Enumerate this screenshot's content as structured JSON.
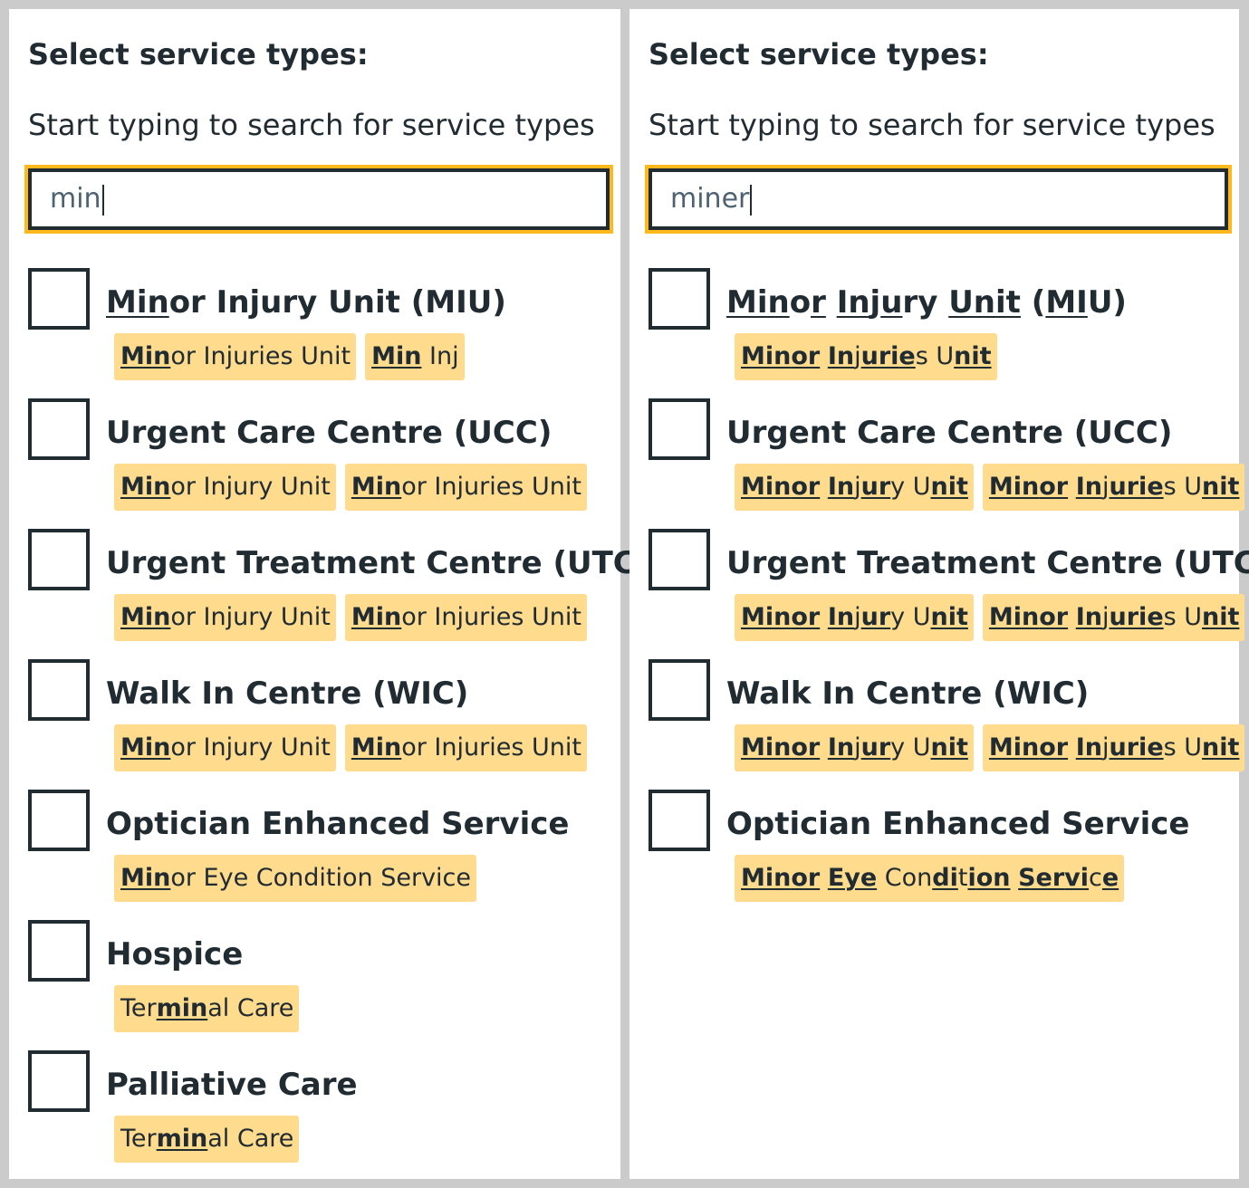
{
  "left": {
    "heading": "Select service types:",
    "hint": "Start typing to search for service types",
    "query": "min",
    "options": [
      {
        "label": [
          {
            "t": "Min",
            "u": true
          },
          {
            "t": "or Injury Unit (MIU)",
            "u": false
          }
        ],
        "tags": [
          [
            {
              "t": "Min",
              "u": true
            },
            {
              "t": "or Injuries Unit",
              "u": false
            }
          ],
          [
            {
              "t": "Min",
              "u": true
            },
            {
              "t": " Inj",
              "u": false
            }
          ]
        ]
      },
      {
        "label": [
          {
            "t": "Urgent Care Centre (UCC)",
            "u": false
          }
        ],
        "tags": [
          [
            {
              "t": "Min",
              "u": true
            },
            {
              "t": "or Injury Unit",
              "u": false
            }
          ],
          [
            {
              "t": "Min",
              "u": true
            },
            {
              "t": "or Injuries Unit",
              "u": false
            }
          ]
        ]
      },
      {
        "label": [
          {
            "t": "Urgent Treatment Centre (UTC)",
            "u": false
          }
        ],
        "tags": [
          [
            {
              "t": "Min",
              "u": true
            },
            {
              "t": "or Injury Unit",
              "u": false
            }
          ],
          [
            {
              "t": "Min",
              "u": true
            },
            {
              "t": "or Injuries Unit",
              "u": false
            }
          ]
        ]
      },
      {
        "label": [
          {
            "t": "Walk In Centre (WIC)",
            "u": false
          }
        ],
        "tags": [
          [
            {
              "t": "Min",
              "u": true
            },
            {
              "t": "or Injury Unit",
              "u": false
            }
          ],
          [
            {
              "t": "Min",
              "u": true
            },
            {
              "t": "or Injuries Unit",
              "u": false
            }
          ]
        ]
      },
      {
        "label": [
          {
            "t": "Optician Enhanced Service",
            "u": false
          }
        ],
        "tags": [
          [
            {
              "t": "Min",
              "u": true
            },
            {
              "t": "or Eye Condition Service",
              "u": false
            }
          ]
        ]
      },
      {
        "label": [
          {
            "t": "Hospice",
            "u": false
          }
        ],
        "tags": [
          [
            {
              "t": "Ter",
              "u": false
            },
            {
              "t": "min",
              "u": true
            },
            {
              "t": "al Care",
              "u": false
            }
          ]
        ]
      },
      {
        "label": [
          {
            "t": "Palliative Care",
            "u": false
          }
        ],
        "tags": [
          [
            {
              "t": "Ter",
              "u": false
            },
            {
              "t": "min",
              "u": true
            },
            {
              "t": "al Care",
              "u": false
            }
          ]
        ]
      }
    ]
  },
  "right": {
    "heading": "Select service types:",
    "hint": "Start typing to search for service types",
    "query": "miner",
    "options": [
      {
        "label": [
          {
            "t": "Min",
            "u": true
          },
          {
            "t": "o",
            "u": false
          },
          {
            "t": "r",
            "u": true
          },
          {
            "t": " ",
            "u": false
          },
          {
            "t": "In",
            "u": true
          },
          {
            "t": "j",
            "u": false
          },
          {
            "t": "u",
            "u": true
          },
          {
            "t": "ry ",
            "u": false
          },
          {
            "t": "Un",
            "u": true
          },
          {
            "t": "it",
            "u": true
          },
          {
            "t": " (",
            "u": false
          },
          {
            "t": "MI",
            "u": true
          },
          {
            "t": "U)",
            "u": false
          }
        ],
        "tags": [
          [
            {
              "t": "Min",
              "u": true
            },
            {
              "t": "or",
              "u": true
            },
            {
              "t": " ",
              "u": false
            },
            {
              "t": "In",
              "u": true
            },
            {
              "t": "j",
              "u": false
            },
            {
              "t": "uri",
              "u": true
            },
            {
              "t": "e",
              "u": true
            },
            {
              "t": "s U",
              "u": false
            },
            {
              "t": "nit",
              "u": true
            }
          ]
        ]
      },
      {
        "label": [
          {
            "t": "Urgent Care Centre (UCC)",
            "u": false
          }
        ],
        "tags": [
          [
            {
              "t": "Min",
              "u": true
            },
            {
              "t": "or",
              "u": true
            },
            {
              "t": " ",
              "u": false
            },
            {
              "t": "In",
              "u": true
            },
            {
              "t": "j",
              "u": false
            },
            {
              "t": "ur",
              "u": true
            },
            {
              "t": "y U",
              "u": false
            },
            {
              "t": "nit",
              "u": true
            }
          ],
          [
            {
              "t": "Min",
              "u": true
            },
            {
              "t": "or",
              "u": true
            },
            {
              "t": " ",
              "u": false
            },
            {
              "t": "In",
              "u": true
            },
            {
              "t": "j",
              "u": false
            },
            {
              "t": "uri",
              "u": true
            },
            {
              "t": "e",
              "u": true
            },
            {
              "t": "s U",
              "u": false
            },
            {
              "t": "nit",
              "u": true
            }
          ]
        ]
      },
      {
        "label": [
          {
            "t": "Urgent Treatment Centre (UTC)",
            "u": false
          }
        ],
        "tags": [
          [
            {
              "t": "Min",
              "u": true
            },
            {
              "t": "or",
              "u": true
            },
            {
              "t": " ",
              "u": false
            },
            {
              "t": "In",
              "u": true
            },
            {
              "t": "j",
              "u": false
            },
            {
              "t": "ur",
              "u": true
            },
            {
              "t": "y U",
              "u": false
            },
            {
              "t": "nit",
              "u": true
            }
          ],
          [
            {
              "t": "Min",
              "u": true
            },
            {
              "t": "or",
              "u": true
            },
            {
              "t": " ",
              "u": false
            },
            {
              "t": "In",
              "u": true
            },
            {
              "t": "j",
              "u": false
            },
            {
              "t": "uri",
              "u": true
            },
            {
              "t": "e",
              "u": true
            },
            {
              "t": "s U",
              "u": false
            },
            {
              "t": "nit",
              "u": true
            }
          ]
        ]
      },
      {
        "label": [
          {
            "t": "Walk In Centre (WIC)",
            "u": false
          }
        ],
        "tags": [
          [
            {
              "t": "Min",
              "u": true
            },
            {
              "t": "or",
              "u": true
            },
            {
              "t": " ",
              "u": false
            },
            {
              "t": "In",
              "u": true
            },
            {
              "t": "j",
              "u": false
            },
            {
              "t": "ur",
              "u": true
            },
            {
              "t": "y U",
              "u": false
            },
            {
              "t": "nit",
              "u": true
            }
          ],
          [
            {
              "t": "Min",
              "u": true
            },
            {
              "t": "or",
              "u": true
            },
            {
              "t": " ",
              "u": false
            },
            {
              "t": "In",
              "u": true
            },
            {
              "t": "j",
              "u": false
            },
            {
              "t": "uri",
              "u": true
            },
            {
              "t": "e",
              "u": true
            },
            {
              "t": "s U",
              "u": false
            },
            {
              "t": "nit",
              "u": true
            }
          ]
        ]
      },
      {
        "label": [
          {
            "t": "Optician Enhanced Service",
            "u": false
          }
        ],
        "tags": [
          [
            {
              "t": "Min",
              "u": true
            },
            {
              "t": "or",
              "u": true
            },
            {
              "t": " ",
              "u": false
            },
            {
              "t": "Eye",
              "u": true
            },
            {
              "t": " Con",
              "u": false
            },
            {
              "t": "di",
              "u": true
            },
            {
              "t": "t",
              "u": false
            },
            {
              "t": "i",
              "u": true
            },
            {
              "t": "on",
              "u": true
            },
            {
              "t": " ",
              "u": false
            },
            {
              "t": "Ser",
              "u": true
            },
            {
              "t": "vi",
              "u": true
            },
            {
              "t": "c",
              "u": false
            },
            {
              "t": "e",
              "u": true
            }
          ]
        ]
      }
    ]
  }
}
